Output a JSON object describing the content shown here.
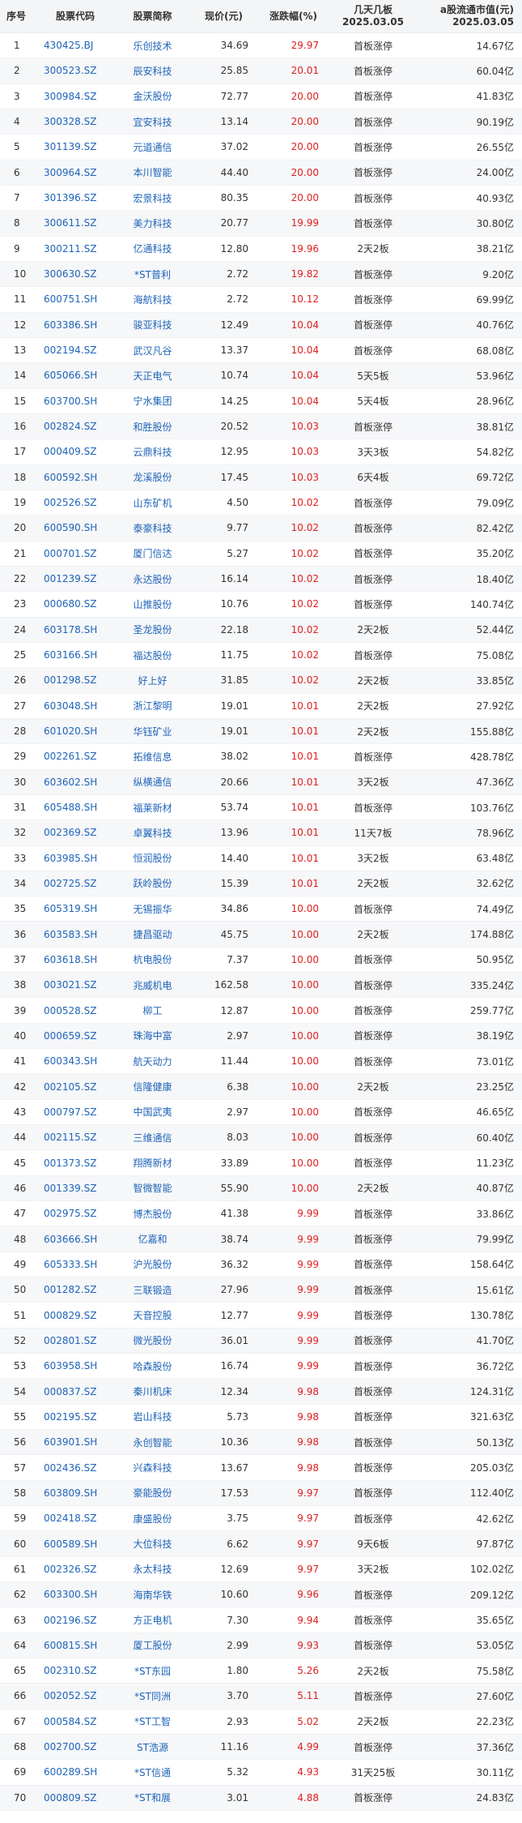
{
  "headers": {
    "idx": "序号",
    "code": "股票代码",
    "name": "股票简称",
    "price": "现价(元)",
    "pct": "涨跌幅(%)",
    "board_l1": "几天几板",
    "board_l2": "2025.03.05",
    "cap_l1": "a股流通市值(元)",
    "cap_l2": "2025.03.05"
  },
  "rows": [
    [
      "1",
      "430425.BJ",
      "乐创技术",
      "34.69",
      "29.97",
      "首板涨停",
      "14.67亿"
    ],
    [
      "2",
      "300523.SZ",
      "辰安科技",
      "25.85",
      "20.01",
      "首板涨停",
      "60.04亿"
    ],
    [
      "3",
      "300984.SZ",
      "金沃股份",
      "72.77",
      "20.00",
      "首板涨停",
      "41.83亿"
    ],
    [
      "4",
      "300328.SZ",
      "宜安科技",
      "13.14",
      "20.00",
      "首板涨停",
      "90.19亿"
    ],
    [
      "5",
      "301139.SZ",
      "元道通信",
      "37.02",
      "20.00",
      "首板涨停",
      "26.55亿"
    ],
    [
      "6",
      "300964.SZ",
      "本川智能",
      "44.40",
      "20.00",
      "首板涨停",
      "24.00亿"
    ],
    [
      "7",
      "301396.SZ",
      "宏景科技",
      "80.35",
      "20.00",
      "首板涨停",
      "40.93亿"
    ],
    [
      "8",
      "300611.SZ",
      "美力科技",
      "20.77",
      "19.99",
      "首板涨停",
      "30.80亿"
    ],
    [
      "9",
      "300211.SZ",
      "亿通科技",
      "12.80",
      "19.96",
      "2天2板",
      "38.21亿"
    ],
    [
      "10",
      "300630.SZ",
      "*ST普利",
      "2.72",
      "19.82",
      "首板涨停",
      "9.20亿"
    ],
    [
      "11",
      "600751.SH",
      "海航科技",
      "2.72",
      "10.12",
      "首板涨停",
      "69.99亿"
    ],
    [
      "12",
      "603386.SH",
      "骏亚科技",
      "12.49",
      "10.04",
      "首板涨停",
      "40.76亿"
    ],
    [
      "13",
      "002194.SZ",
      "武汉凡谷",
      "13.37",
      "10.04",
      "首板涨停",
      "68.08亿"
    ],
    [
      "14",
      "605066.SH",
      "天正电气",
      "10.74",
      "10.04",
      "5天5板",
      "53.96亿"
    ],
    [
      "15",
      "603700.SH",
      "宁水集团",
      "14.25",
      "10.04",
      "5天4板",
      "28.96亿"
    ],
    [
      "16",
      "002824.SZ",
      "和胜股份",
      "20.52",
      "10.03",
      "首板涨停",
      "38.81亿"
    ],
    [
      "17",
      "000409.SZ",
      "云鼎科技",
      "12.95",
      "10.03",
      "3天3板",
      "54.82亿"
    ],
    [
      "18",
      "600592.SH",
      "龙溪股份",
      "17.45",
      "10.03",
      "6天4板",
      "69.72亿"
    ],
    [
      "19",
      "002526.SZ",
      "山东矿机",
      "4.50",
      "10.02",
      "首板涨停",
      "79.09亿"
    ],
    [
      "20",
      "600590.SH",
      "泰豪科技",
      "9.77",
      "10.02",
      "首板涨停",
      "82.42亿"
    ],
    [
      "21",
      "000701.SZ",
      "厦门信达",
      "5.27",
      "10.02",
      "首板涨停",
      "35.20亿"
    ],
    [
      "22",
      "001239.SZ",
      "永达股份",
      "16.14",
      "10.02",
      "首板涨停",
      "18.40亿"
    ],
    [
      "23",
      "000680.SZ",
      "山推股份",
      "10.76",
      "10.02",
      "首板涨停",
      "140.74亿"
    ],
    [
      "24",
      "603178.SH",
      "圣龙股份",
      "22.18",
      "10.02",
      "2天2板",
      "52.44亿"
    ],
    [
      "25",
      "603166.SH",
      "福达股份",
      "11.75",
      "10.02",
      "首板涨停",
      "75.08亿"
    ],
    [
      "26",
      "001298.SZ",
      "好上好",
      "31.85",
      "10.02",
      "2天2板",
      "33.85亿"
    ],
    [
      "27",
      "603048.SH",
      "浙江黎明",
      "19.01",
      "10.01",
      "2天2板",
      "27.92亿"
    ],
    [
      "28",
      "601020.SH",
      "华钰矿业",
      "19.01",
      "10.01",
      "2天2板",
      "155.88亿"
    ],
    [
      "29",
      "002261.SZ",
      "拓维信息",
      "38.02",
      "10.01",
      "首板涨停",
      "428.78亿"
    ],
    [
      "30",
      "603602.SH",
      "纵横通信",
      "20.66",
      "10.01",
      "3天2板",
      "47.36亿"
    ],
    [
      "31",
      "605488.SH",
      "福莱新材",
      "53.74",
      "10.01",
      "首板涨停",
      "103.76亿"
    ],
    [
      "32",
      "002369.SZ",
      "卓翼科技",
      "13.96",
      "10.01",
      "11天7板",
      "78.96亿"
    ],
    [
      "33",
      "603985.SH",
      "恒润股份",
      "14.40",
      "10.01",
      "3天2板",
      "63.48亿"
    ],
    [
      "34",
      "002725.SZ",
      "跃岭股份",
      "15.39",
      "10.01",
      "2天2板",
      "32.62亿"
    ],
    [
      "35",
      "605319.SH",
      "无锡振华",
      "34.86",
      "10.00",
      "首板涨停",
      "74.49亿"
    ],
    [
      "36",
      "603583.SH",
      "捷昌驱动",
      "45.75",
      "10.00",
      "2天2板",
      "174.88亿"
    ],
    [
      "37",
      "603618.SH",
      "杭电股份",
      "7.37",
      "10.00",
      "首板涨停",
      "50.95亿"
    ],
    [
      "38",
      "003021.SZ",
      "兆威机电",
      "162.58",
      "10.00",
      "首板涨停",
      "335.24亿"
    ],
    [
      "39",
      "000528.SZ",
      "柳工",
      "12.87",
      "10.00",
      "首板涨停",
      "259.77亿"
    ],
    [
      "40",
      "000659.SZ",
      "珠海中富",
      "2.97",
      "10.00",
      "首板涨停",
      "38.19亿"
    ],
    [
      "41",
      "600343.SH",
      "航天动力",
      "11.44",
      "10.00",
      "首板涨停",
      "73.01亿"
    ],
    [
      "42",
      "002105.SZ",
      "信隆健康",
      "6.38",
      "10.00",
      "2天2板",
      "23.25亿"
    ],
    [
      "43",
      "000797.SZ",
      "中国武夷",
      "2.97",
      "10.00",
      "首板涨停",
      "46.65亿"
    ],
    [
      "44",
      "002115.SZ",
      "三维通信",
      "8.03",
      "10.00",
      "首板涨停",
      "60.40亿"
    ],
    [
      "45",
      "001373.SZ",
      "翔腾新材",
      "33.89",
      "10.00",
      "首板涨停",
      "11.23亿"
    ],
    [
      "46",
      "001339.SZ",
      "智微智能",
      "55.90",
      "10.00",
      "2天2板",
      "40.87亿"
    ],
    [
      "47",
      "002975.SZ",
      "博杰股份",
      "41.38",
      "9.99",
      "首板涨停",
      "33.86亿"
    ],
    [
      "48",
      "603666.SH",
      "亿嘉和",
      "38.74",
      "9.99",
      "首板涨停",
      "79.99亿"
    ],
    [
      "49",
      "605333.SH",
      "沪光股份",
      "36.32",
      "9.99",
      "首板涨停",
      "158.64亿"
    ],
    [
      "50",
      "001282.SZ",
      "三联锻造",
      "27.96",
      "9.99",
      "首板涨停",
      "15.61亿"
    ],
    [
      "51",
      "000829.SZ",
      "天音控股",
      "12.77",
      "9.99",
      "首板涨停",
      "130.78亿"
    ],
    [
      "52",
      "002801.SZ",
      "微光股份",
      "36.01",
      "9.99",
      "首板涨停",
      "41.70亿"
    ],
    [
      "53",
      "603958.SH",
      "哈森股份",
      "16.74",
      "9.99",
      "首板涨停",
      "36.72亿"
    ],
    [
      "54",
      "000837.SZ",
      "秦川机床",
      "12.34",
      "9.98",
      "首板涨停",
      "124.31亿"
    ],
    [
      "55",
      "002195.SZ",
      "岩山科技",
      "5.73",
      "9.98",
      "首板涨停",
      "321.63亿"
    ],
    [
      "56",
      "603901.SH",
      "永创智能",
      "10.36",
      "9.98",
      "首板涨停",
      "50.13亿"
    ],
    [
      "57",
      "002436.SZ",
      "兴森科技",
      "13.67",
      "9.98",
      "首板涨停",
      "205.03亿"
    ],
    [
      "58",
      "603809.SH",
      "豪能股份",
      "17.53",
      "9.97",
      "首板涨停",
      "112.40亿"
    ],
    [
      "59",
      "002418.SZ",
      "康盛股份",
      "3.75",
      "9.97",
      "首板涨停",
      "42.62亿"
    ],
    [
      "60",
      "600589.SH",
      "大位科技",
      "6.62",
      "9.97",
      "9天6板",
      "97.87亿"
    ],
    [
      "61",
      "002326.SZ",
      "永太科技",
      "12.69",
      "9.97",
      "3天2板",
      "102.02亿"
    ],
    [
      "62",
      "603300.SH",
      "海南华铁",
      "10.60",
      "9.96",
      "首板涨停",
      "209.12亿"
    ],
    [
      "63",
      "002196.SZ",
      "方正电机",
      "7.30",
      "9.94",
      "首板涨停",
      "35.65亿"
    ],
    [
      "64",
      "600815.SH",
      "厦工股份",
      "2.99",
      "9.93",
      "首板涨停",
      "53.05亿"
    ],
    [
      "65",
      "002310.SZ",
      "*ST东园",
      "1.80",
      "5.26",
      "2天2板",
      "75.58亿"
    ],
    [
      "66",
      "002052.SZ",
      "*ST同洲",
      "3.70",
      "5.11",
      "首板涨停",
      "27.60亿"
    ],
    [
      "67",
      "000584.SZ",
      "*ST工智",
      "2.93",
      "5.02",
      "2天2板",
      "22.23亿"
    ],
    [
      "68",
      "002700.SZ",
      "ST浩源",
      "11.16",
      "4.99",
      "首板涨停",
      "37.36亿"
    ],
    [
      "69",
      "600289.SH",
      "*ST信通",
      "5.32",
      "4.93",
      "31天25板",
      "30.11亿"
    ],
    [
      "70",
      "000809.SZ",
      "*ST和展",
      "3.01",
      "4.88",
      "首板涨停",
      "24.83亿"
    ]
  ]
}
